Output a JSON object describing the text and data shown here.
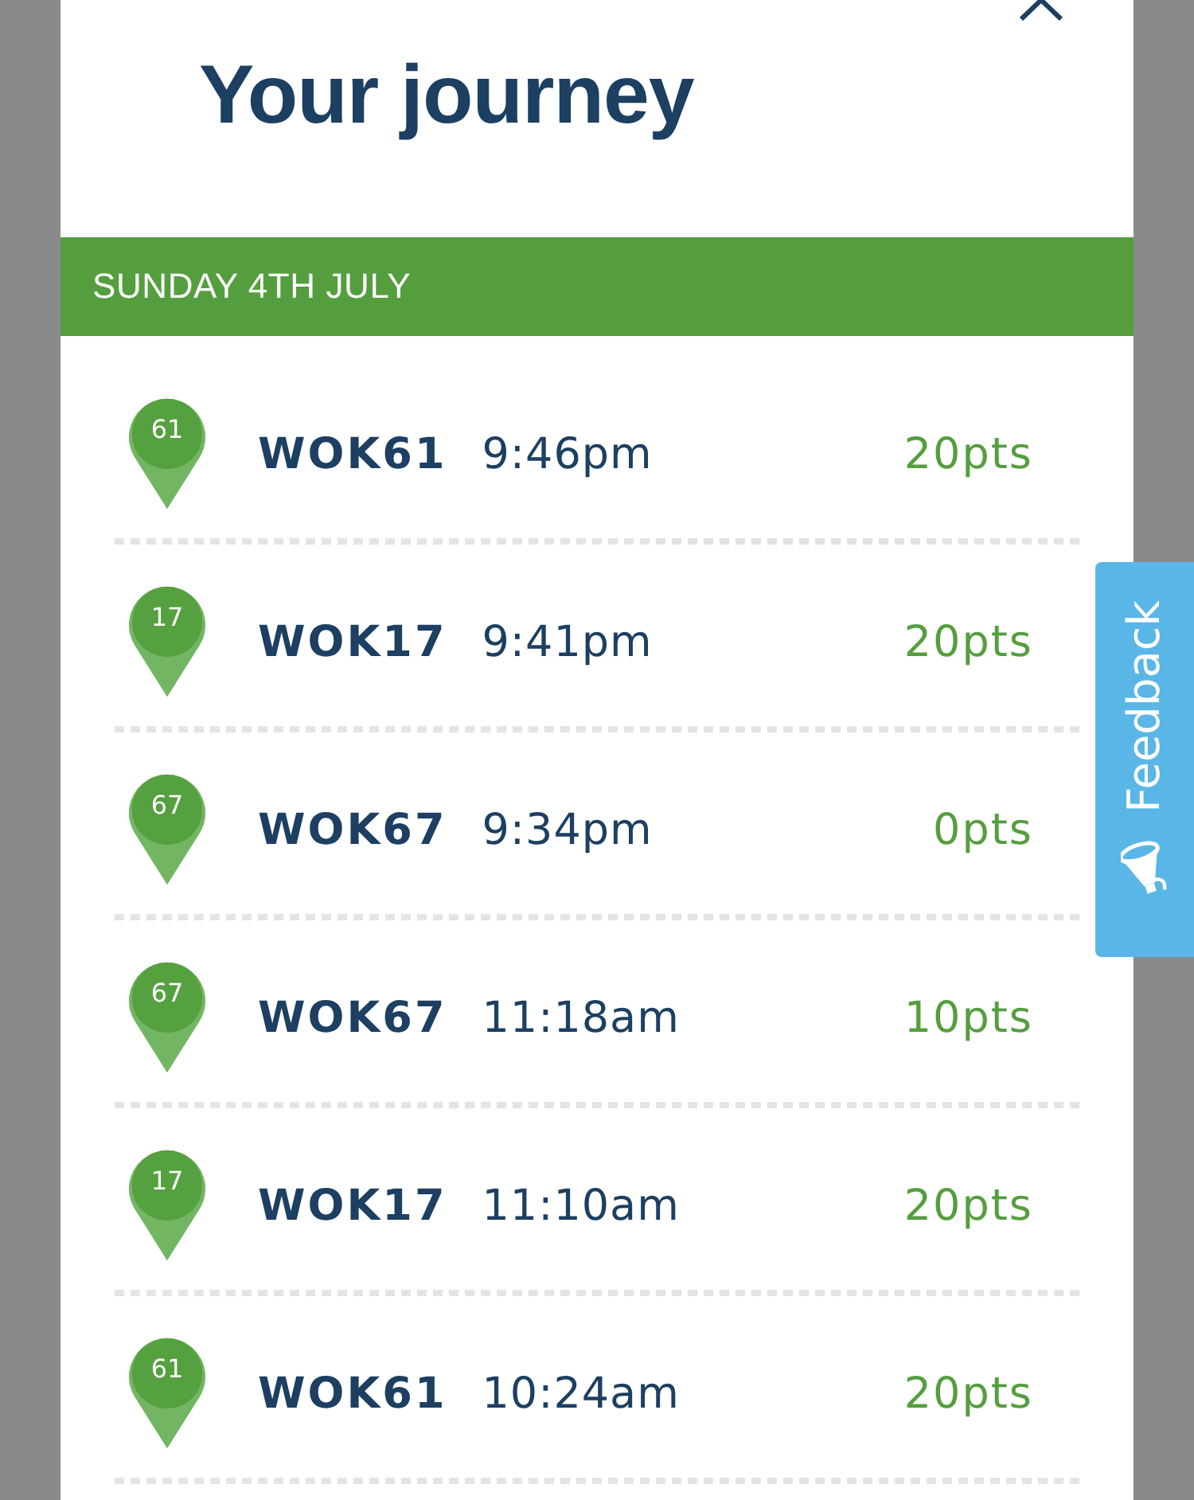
{
  "header": {
    "title": "Your journey"
  },
  "date_band": {
    "label": "SUNDAY 4TH JULY"
  },
  "journeys": [
    {
      "route": "61",
      "code": "WOK61",
      "time": "9:46pm",
      "points": "20pts"
    },
    {
      "route": "17",
      "code": "WOK17",
      "time": "9:41pm",
      "points": "20pts"
    },
    {
      "route": "67",
      "code": "WOK67",
      "time": "9:34pm",
      "points": "0pts"
    },
    {
      "route": "67",
      "code": "WOK67",
      "time": "11:18am",
      "points": "10pts"
    },
    {
      "route": "17",
      "code": "WOK17",
      "time": "11:10am",
      "points": "20pts"
    },
    {
      "route": "61",
      "code": "WOK61",
      "time": "10:24am",
      "points": "20pts"
    }
  ],
  "feedback_tab": {
    "label": "Feedback"
  }
}
